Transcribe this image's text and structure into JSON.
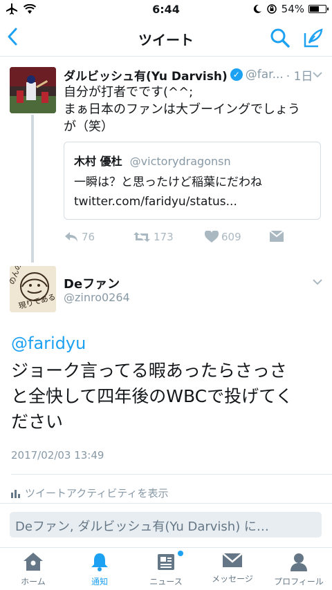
{
  "status_bar": {
    "time": "6:44",
    "battery_percent": "54%",
    "battery_level": 0.54
  },
  "nav": {
    "title": "ツイート",
    "back_icon": "chevron-left-icon",
    "search_icon": "search-icon",
    "compose_icon": "compose-icon"
  },
  "tweet1": {
    "name": "ダルビッシュ有(Yu Darvish)",
    "handle": "@far...",
    "time": "· 1日",
    "text_line1": "自分が打者でです(^^;",
    "text_line2": "まぁ日本のファンは大ブーイングでしょう",
    "text_line3": "が（笑）",
    "quote": {
      "name": "木村 優杜",
      "handle": "@victorydragonsn",
      "text_line1": "一瞬は？と思ったけど稲葉にだわね",
      "text_line2": "twitter.com/faridyu/status..."
    },
    "replies": "76",
    "retweets": "173",
    "likes": "609"
  },
  "tweet2": {
    "name": "Deファン",
    "handle": "@zinro0264",
    "mention": "@faridyu",
    "text_line1": "ジョーク言ってる暇あったらさっさ",
    "text_line2": "と全快して四年後のWBCで投げてく",
    "text_line3": "ださい",
    "date": "2017/02/03 13:49",
    "activity": "ツイートアクティビティを表示",
    "avatar_text_1": "のんのん",
    "avatar_text_2": "現りである"
  },
  "reply": {
    "placeholder": "Deファン, ダルビッシュ有(Yu Darvish) に…"
  },
  "tabs": [
    {
      "label": "ホーム",
      "icon": "home-icon"
    },
    {
      "label": "通知",
      "icon": "bell-icon"
    },
    {
      "label": "ニュース",
      "icon": "news-icon"
    },
    {
      "label": "メッセージ",
      "icon": "mail-icon"
    },
    {
      "label": "プロフィール",
      "icon": "person-icon"
    }
  ],
  "colors": {
    "accent": "#1da1f2",
    "muted": "#8899a6",
    "text": "#14171a"
  }
}
